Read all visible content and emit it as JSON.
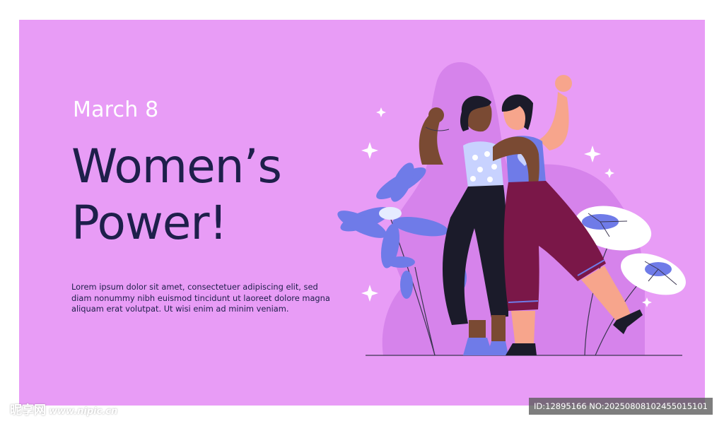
{
  "banner": {
    "date": "March 8",
    "title_line1": "Women’s",
    "title_line2": "Power!",
    "body": "Lorem ipsum dolor sit amet, consectetuer adipiscing elit, sed diam nonummy nibh euismod tincidunt ut laoreet dolore magna aliquam erat volutpat. Ut wisi enim ad minim veniam."
  },
  "colors": {
    "background": "#e89cf6",
    "title": "#1e1f4b",
    "date": "#ffffff",
    "flower_blue": "#6f7be8",
    "trousers_maroon": "#7a1748",
    "trousers_black": "#1b1b2a"
  },
  "watermark": {
    "site": "昵享网",
    "url": "www.nipic.cn",
    "id_text": "ID:12895166 NO:20250808102455015101"
  }
}
